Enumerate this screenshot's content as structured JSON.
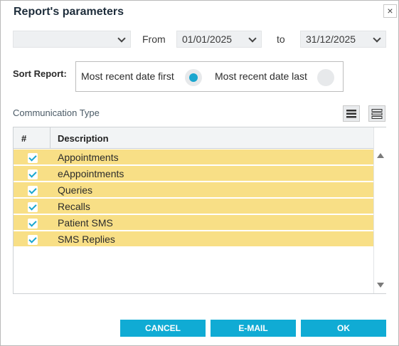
{
  "dialog": {
    "title": "Report's parameters",
    "close_label": "×"
  },
  "filters": {
    "first_select_value": "",
    "from_label": "From",
    "from_date": "01/01/2025",
    "to_label": "to",
    "to_date": "31/12/2025"
  },
  "sort": {
    "label": "Sort Report:",
    "options": [
      {
        "label": "Most recent date first",
        "selected": true
      },
      {
        "label": "Most recent date last",
        "selected": false
      }
    ]
  },
  "communication": {
    "label": "Communication Type",
    "columns": [
      "#",
      "Description"
    ],
    "rows": [
      {
        "checked": true,
        "description": "Appointments"
      },
      {
        "checked": true,
        "description": "eAppointments"
      },
      {
        "checked": true,
        "description": "Queries"
      },
      {
        "checked": true,
        "description": "Recalls"
      },
      {
        "checked": true,
        "description": "Patient SMS"
      },
      {
        "checked": true,
        "description": "SMS Replies"
      }
    ]
  },
  "buttons": {
    "cancel": "CANCEL",
    "email": "E-MAIL",
    "ok": "OK"
  },
  "colors": {
    "accent": "#10abd4",
    "selected_row": "#f8df86"
  }
}
